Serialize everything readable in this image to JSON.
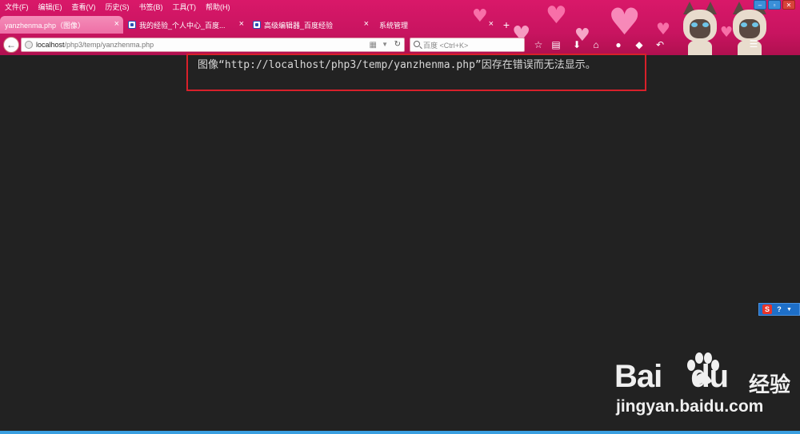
{
  "menubar": {
    "items": [
      "文件(F)",
      "编辑(E)",
      "查看(V)",
      "历史(S)",
      "书签(B)",
      "工具(T)",
      "帮助(H)"
    ]
  },
  "tabs": [
    {
      "label": "yanzhenma.php（图像）",
      "active": true
    },
    {
      "label": "我的经验_个人中心_百度...",
      "active": false
    },
    {
      "label": "高级编辑器_百度经验",
      "active": false
    },
    {
      "label": "系统管理",
      "active": false
    }
  ],
  "navbar": {
    "url_host": "localhost",
    "url_path": "/php3/temp/yanzhenma.php",
    "search_placeholder": "百度 <Ctrl+K>"
  },
  "page": {
    "error_message": "图像“http://localhost/php3/temp/yanzhenma.php”因存在错误而无法显示。"
  },
  "watermark": {
    "logo_prefix": "Bai",
    "logo_suffix": "du",
    "logo_cn": "经验",
    "url": "jingyan.baidu.com"
  },
  "icons": {
    "back": "back-arrow-icon",
    "reload": "reload-icon",
    "search": "search-icon",
    "star": "bookmark-star-icon",
    "download": "download-icon",
    "home": "home-icon",
    "menu": "menu-icon"
  },
  "colors": {
    "chrome": "#c81460",
    "active_tab": "#ee6fa6",
    "page_bg": "#222222",
    "error_border": "#d8202a"
  }
}
